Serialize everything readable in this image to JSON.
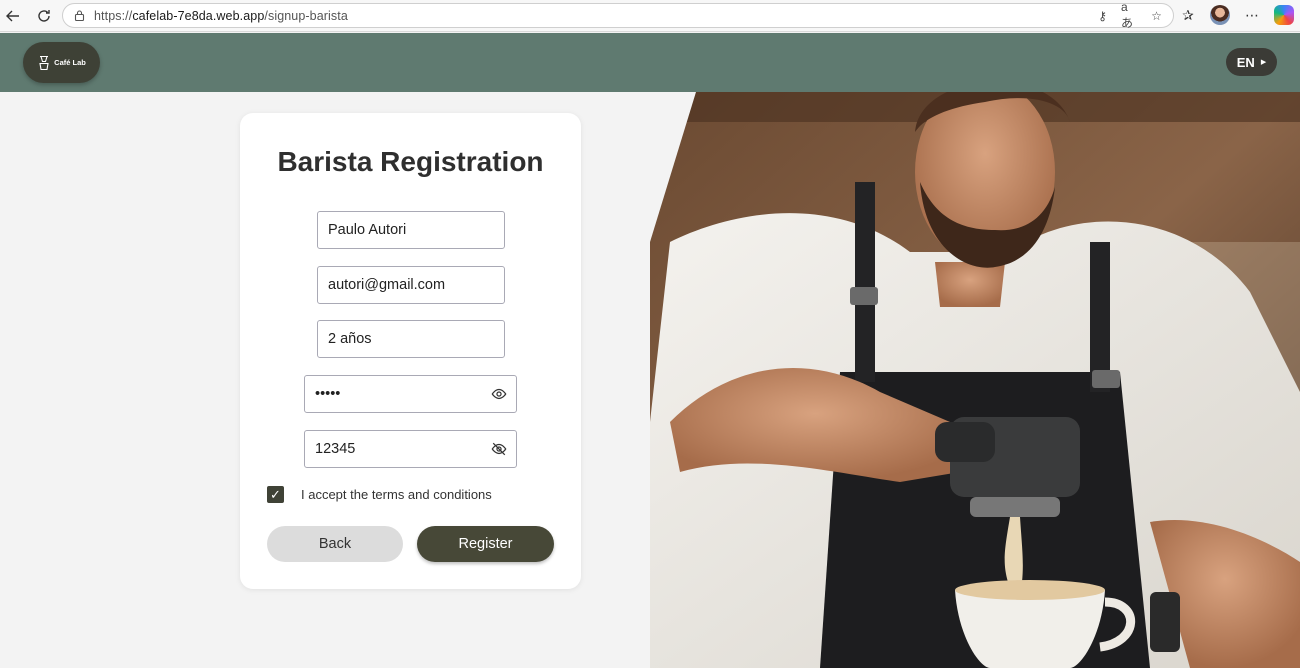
{
  "browser": {
    "url_prefix": "https://",
    "url_domain": "cafelab-7e8da.web.app",
    "url_path": "/signup-barista",
    "translate_glyph": "aあ"
  },
  "header": {
    "logo_text": "Café Lab",
    "language_label": "EN",
    "background_color": "#5f7a70"
  },
  "form": {
    "title": "Barista Registration",
    "name_value": "Paulo Autori",
    "email_value": "autori@gmail.com",
    "experience_value": "2 años",
    "password_value": "12345",
    "password_confirm_value": "12345",
    "terms_label": "I accept the terms and conditions",
    "terms_checked": true,
    "back_label": "Back",
    "register_label": "Register",
    "accent_color": "#474837"
  },
  "icons": {
    "back": "back-arrow-icon",
    "refresh": "refresh-icon",
    "lock": "lock-icon",
    "password_show": "eye-icon",
    "password_hide": "eye-slash-icon",
    "logo": "coffee-dripper-icon"
  }
}
